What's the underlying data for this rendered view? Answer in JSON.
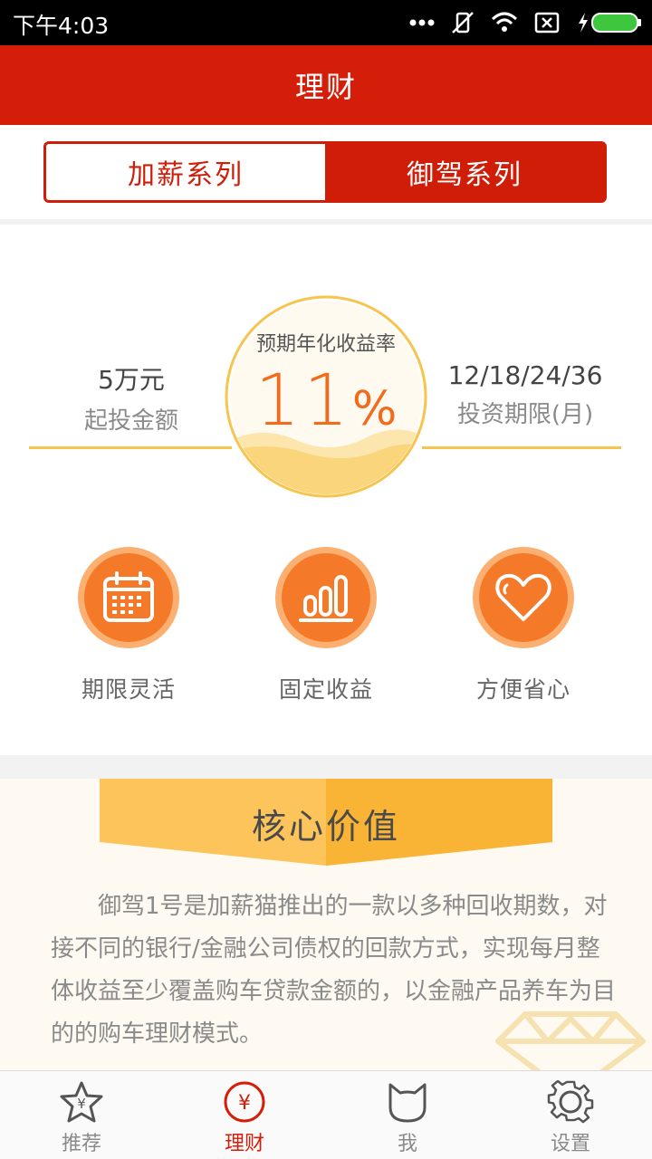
{
  "status_bar": {
    "time": "下午4:03"
  },
  "title": "理财",
  "tabs": [
    {
      "label": "加薪系列",
      "active": true
    },
    {
      "label": "御驾系列",
      "active": false
    }
  ],
  "product": {
    "min_amount": {
      "value": "5万元",
      "label": "起投金额"
    },
    "rate": {
      "label": "预期年化收益率",
      "number": "11",
      "unit": "%"
    },
    "term": {
      "value": "12/18/24/36",
      "label": "投资期限(月)"
    }
  },
  "features": [
    {
      "label": "期限灵活",
      "icon": "calendar-icon"
    },
    {
      "label": "固定收益",
      "icon": "bar-chart-icon"
    },
    {
      "label": "方便省心",
      "icon": "heart-icon"
    }
  ],
  "core": {
    "title": "核心价值",
    "text": "御驾1号是加薪猫推出的一款以多种回收期数，对接不同的银行/金融公司债权的回款方式，实现每月整体收益至少覆盖购车贷款金额的，以金融产品养车为目的的购车理财模式。"
  },
  "nav": [
    {
      "label": "推荐",
      "icon": "star-yen-icon",
      "active": false
    },
    {
      "label": "理财",
      "icon": "yen-circle-icon",
      "active": true
    },
    {
      "label": "我",
      "icon": "cat-icon",
      "active": false
    },
    {
      "label": "设置",
      "icon": "gear-icon",
      "active": false
    }
  ],
  "colors": {
    "brand_red": "#d41e0a",
    "accent_orange": "#f47a2a",
    "gold": "#f7c44d"
  }
}
